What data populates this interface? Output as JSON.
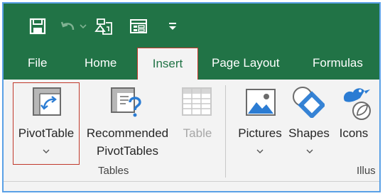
{
  "tabs": [
    {
      "label": "File"
    },
    {
      "label": "Home"
    },
    {
      "label": "Insert"
    },
    {
      "label": "Page Layout"
    },
    {
      "label": "Formulas"
    }
  ],
  "active_tab": "Insert",
  "ribbon": {
    "pivottable": {
      "label": "PivotTable"
    },
    "recommended": {
      "line1": "Recommended",
      "line2": "PivotTables"
    },
    "table": {
      "label": "Table",
      "state": "disabled"
    },
    "pictures": {
      "label": "Pictures"
    },
    "shapes": {
      "label": "Shapes"
    },
    "icons": {
      "label": "Icons"
    },
    "group_tables": "Tables",
    "group_illustrations": "Illus"
  },
  "icons": [
    "save-icon",
    "undo-icon",
    "shape-touch-icon",
    "form-icon",
    "customize-qat-icon",
    "pivottable-icon",
    "recommended-pivot-icon",
    "table-icon",
    "pictures-icon",
    "shapes-icon",
    "icons-icon",
    "chevron-down-icon"
  ],
  "colors": {
    "brand": "#217346",
    "highlight": "#c0392b",
    "frame": "#5aa0e6",
    "ribbon_bg": "#f3f3f3"
  }
}
